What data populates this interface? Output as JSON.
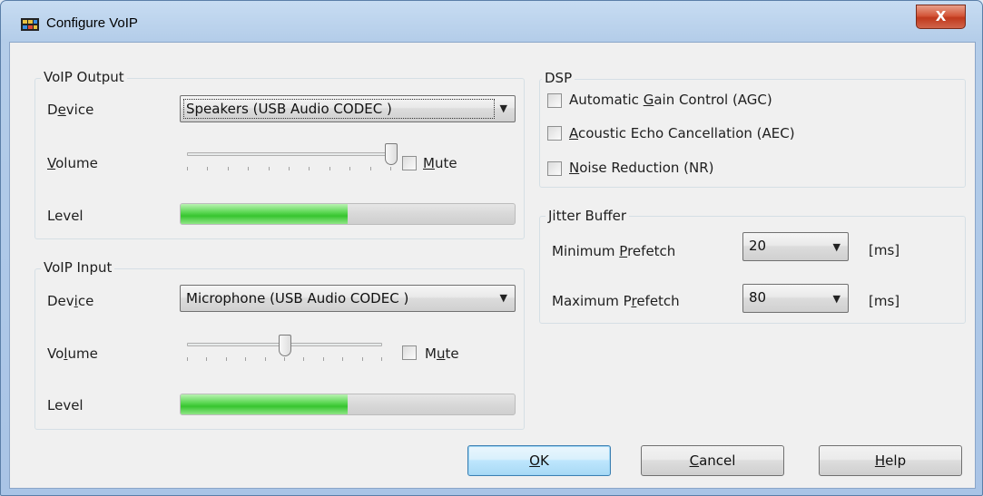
{
  "window": {
    "title": "Configure VoIP",
    "close_glyph": "X"
  },
  "voip_output": {
    "group_label": "VoIP Output",
    "device_label_pre": "D",
    "device_label_acc": "e",
    "device_label_post": "vice",
    "device_value": "Speakers (USB Audio CODEC )",
    "volume_label_acc": "V",
    "volume_label_post": "olume",
    "volume_level": 1.0,
    "mute_label_acc": "M",
    "mute_label_post": "ute",
    "mute_checked": false,
    "level_label": "Level",
    "level_fraction": 0.5
  },
  "voip_input": {
    "group_label": "VoIP Input",
    "device_label_pre": "Dev",
    "device_label_acc": "i",
    "device_label_post": "ce",
    "device_value": "Microphone (USB Audio CODEC )",
    "volume_label_pre": "Vo",
    "volume_label_acc": "l",
    "volume_label_post": "ume",
    "volume_level": 0.5,
    "mute_label_pre": "M",
    "mute_label_acc": "u",
    "mute_label_post": "te",
    "mute_checked": false,
    "level_label": "Level",
    "level_fraction": 0.5
  },
  "dsp": {
    "group_label": "DSP",
    "options": [
      {
        "pre": "Automatic ",
        "acc": "G",
        "post": "ain Control (AGC)",
        "checked": false
      },
      {
        "pre": "",
        "acc": "A",
        "post": "coustic Echo Cancellation (AEC)",
        "checked": false
      },
      {
        "pre": "",
        "acc": "N",
        "post": "oise Reduction (NR)",
        "checked": false
      }
    ]
  },
  "jitter_buffer": {
    "group_label": "Jitter Buffer",
    "min_label_pre": "Minimum ",
    "min_label_acc": "P",
    "min_label_post": "refetch",
    "min_value": "20",
    "max_label_pre": "Maximum P",
    "max_label_acc": "r",
    "max_label_post": "efetch",
    "max_value": "80",
    "unit": "[ms]"
  },
  "buttons": {
    "ok_acc": "O",
    "ok_post": "K",
    "cancel_acc": "C",
    "cancel_post": "ancel",
    "help_acc": "H",
    "help_post": "elp"
  },
  "colors": {
    "meter_green": "#37c52f",
    "default_button_border": "#3c7fb1",
    "close_red": "#c0391d"
  },
  "icons": {
    "app": "voip-app-icon",
    "dropdown": "chevron-down-icon"
  }
}
